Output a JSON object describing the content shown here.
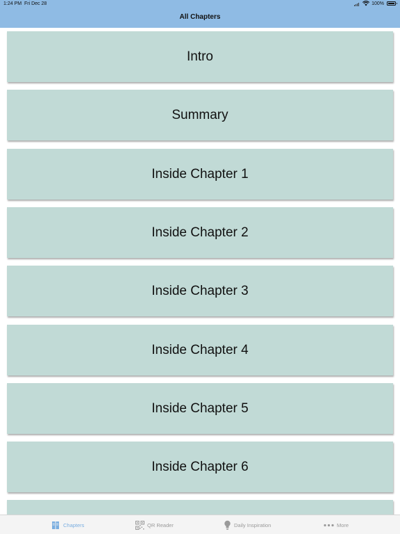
{
  "status": {
    "time": "1:24 PM",
    "date": "Fri Dec 28",
    "battery": "100%"
  },
  "nav": {
    "title": "All Chapters"
  },
  "chapters": [
    {
      "label": "Intro"
    },
    {
      "label": "Summary"
    },
    {
      "label": "Inside Chapter 1"
    },
    {
      "label": "Inside Chapter 2"
    },
    {
      "label": "Inside Chapter 3"
    },
    {
      "label": "Inside Chapter 4"
    },
    {
      "label": "Inside Chapter 5"
    },
    {
      "label": "Inside Chapter 6"
    },
    {
      "label": ""
    }
  ],
  "tabs": [
    {
      "label": "Chapters",
      "icon": "book-icon",
      "active": true
    },
    {
      "label": "QR Reader",
      "icon": "qr-code-icon",
      "active": false
    },
    {
      "label": "Daily Inspiration",
      "icon": "lightbulb-icon",
      "active": false
    },
    {
      "label": "More",
      "icon": "more-dots-icon",
      "active": false
    }
  ],
  "colors": {
    "nav_bar": "#8fbbe4",
    "row_background": "#c1dad6",
    "tab_active": "#7aaee0",
    "tab_inactive": "#9a9a9a"
  }
}
